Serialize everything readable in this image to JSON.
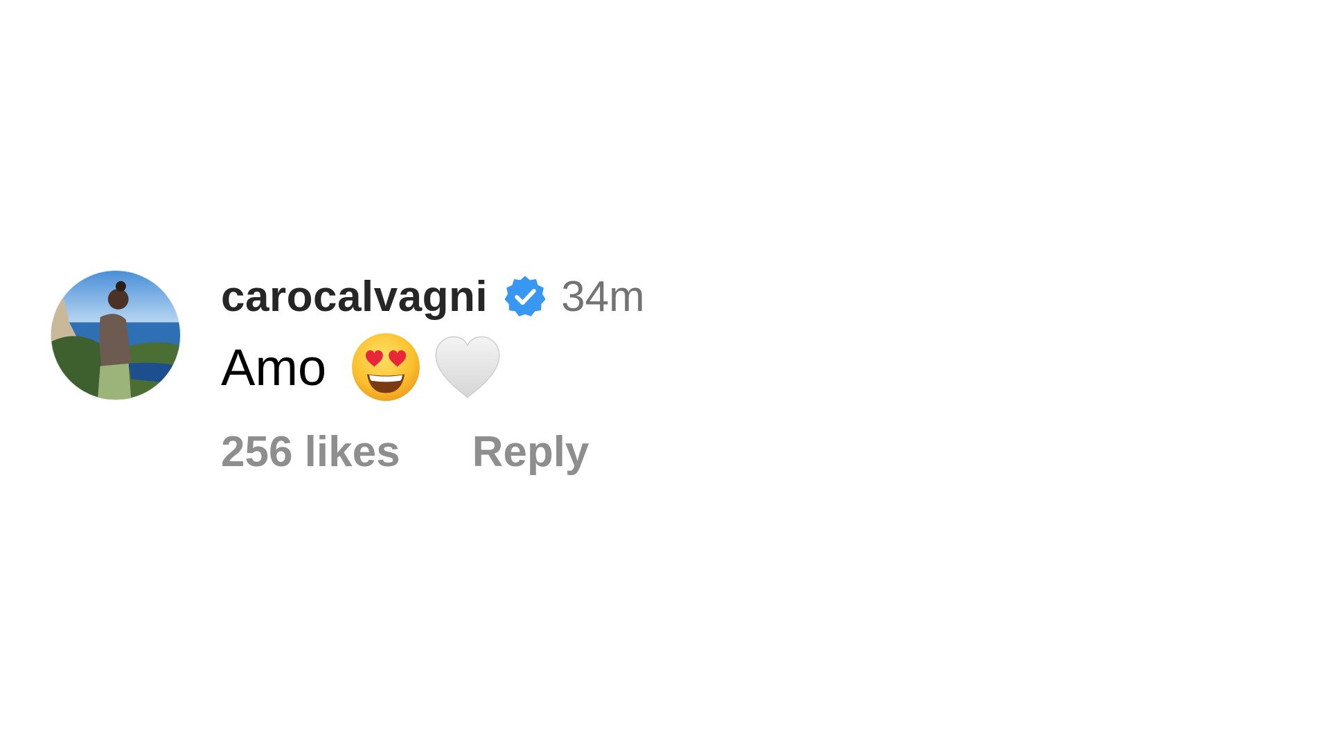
{
  "comment": {
    "username": "carocalvagni",
    "verified": true,
    "timestamp": "34m",
    "text": "Amo",
    "emojis": [
      "smiling-face-with-heart-eyes-icon",
      "white-heart-icon"
    ],
    "likes_label": "256 likes",
    "reply_label": "Reply"
  },
  "colors": {
    "username": "#262626",
    "meta": "#737373",
    "action": "#8e8e8e",
    "verified_badge": "#3897f0"
  }
}
